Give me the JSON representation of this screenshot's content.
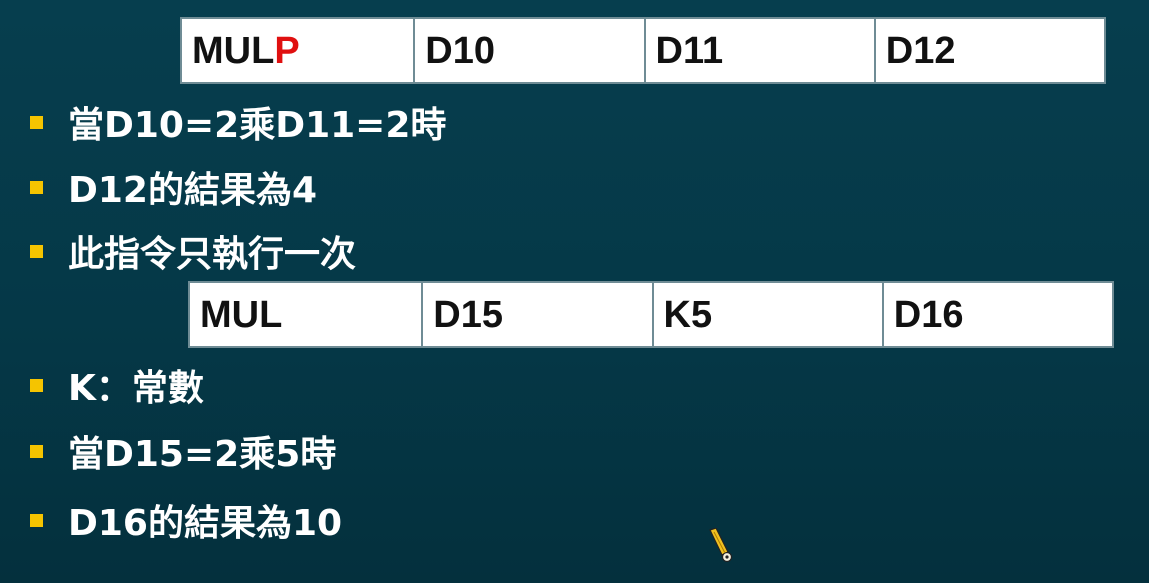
{
  "colors": {
    "background": "#053a4a",
    "bullet_marker": "#f5c400",
    "text": "#ffffff",
    "table_bg": "#ffffff",
    "table_text": "#111111",
    "op_highlight": "#e01010"
  },
  "table1": {
    "op_base": "MUL",
    "op_suffix": "P",
    "op1": "D10",
    "op2": "D11",
    "dest": "D12"
  },
  "bullets_group1": [
    "當D10=2乘D11=2時",
    "D12的結果為4",
    "此指令只執行一次"
  ],
  "table2": {
    "op": "MUL",
    "op1": "D15",
    "op2": "K5",
    "dest": "D16"
  },
  "bullets_group2": [
    "K：常數",
    "當D15=2乘5時",
    "D16的結果為10"
  ],
  "cursor": {
    "icon": "pen-cursor-icon"
  }
}
